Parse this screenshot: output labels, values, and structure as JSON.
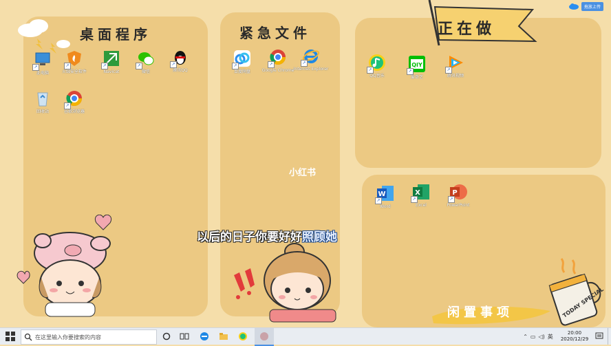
{
  "panels": {
    "desktop_programs": "桌面程序",
    "urgent_files": "紧急文件",
    "in_progress": "正在做",
    "idle_matters": "闲置事项"
  },
  "desktop_icons": [
    {
      "label": "此电脑",
      "icon": "computer-icon"
    },
    {
      "label": "火绒安全软件",
      "icon": "huorong-shield-icon"
    },
    {
      "label": "Navicat",
      "icon": "navicat-icon"
    },
    {
      "label": "微信",
      "icon": "wechat-icon"
    },
    {
      "label": "腾讯QQ",
      "icon": "qq-penguin-icon"
    },
    {
      "label": "回收站",
      "icon": "recycle-bin-icon"
    },
    {
      "label": "谷歌浏览器",
      "icon": "chrome-icon"
    }
  ],
  "urgent_icons": [
    {
      "label": "百度网盘",
      "icon": "baidu-netdisk-icon"
    },
    {
      "label": "Google Chrome",
      "icon": "chrome-icon"
    },
    {
      "label": "Internet Explorer",
      "icon": "ie-icon"
    }
  ],
  "progress_icons": [
    {
      "label": "QQ音乐",
      "icon": "qq-music-icon"
    },
    {
      "label": "爱奇艺",
      "icon": "iqiyi-icon"
    },
    {
      "label": "腾讯视频",
      "icon": "tencent-video-icon"
    }
  ],
  "office_icons": [
    {
      "label": "Word",
      "icon": "word-icon"
    },
    {
      "label": "Excel",
      "icon": "excel-icon"
    },
    {
      "label": "PowerPoint",
      "icon": "powerpoint-icon"
    }
  ],
  "overlay": {
    "watermark": "小红书",
    "caption_main": "以后的日子你要好好",
    "caption_highlight": "照顾她",
    "mug_text": "TODAY SPECIAL"
  },
  "top_right": {
    "upload_label": "拖放上传"
  },
  "taskbar": {
    "search_placeholder": "在这里输入你要搜索的内容",
    "time": "20:00",
    "date": "2020/12/29"
  },
  "colors": {
    "panel": "#ecc983",
    "background": "#f5deaa",
    "accent_blue": "#1f4a8c"
  }
}
